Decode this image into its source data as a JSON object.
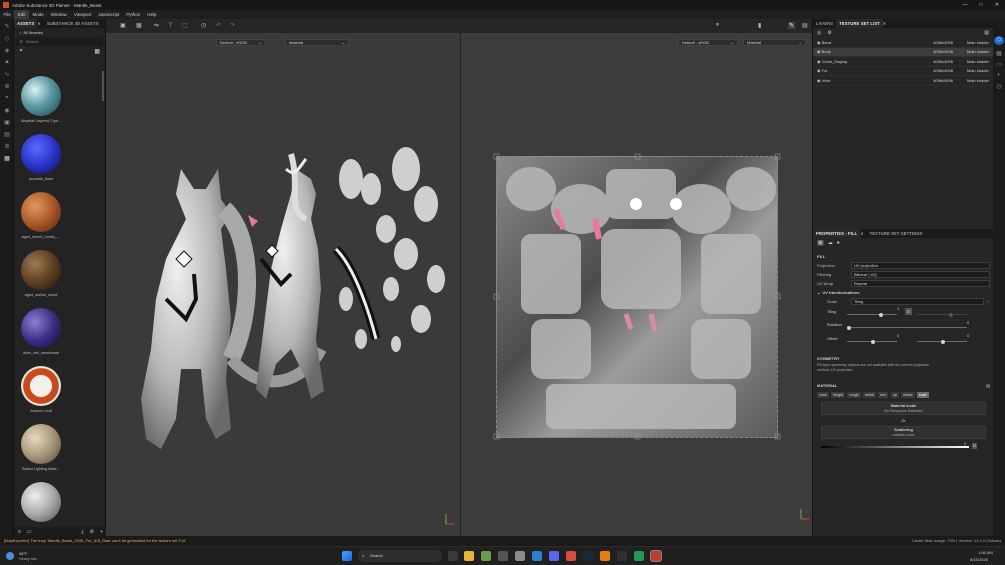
{
  "window": {
    "title": "Adobe Substance 3D Painter - Mantle_Beast"
  },
  "menu": [
    "File",
    "Edit",
    "Mode",
    "Window",
    "Viewport",
    "JavaScript",
    "Python",
    "Help"
  ],
  "assets": {
    "tabs": [
      "ASSETS",
      "SUBSTANCE 3D ASSETS"
    ],
    "library_label": "All libraries",
    "search_placeholder": "Search",
    "items": [
      {
        "name": "Abyssal Layered Crys..."
      },
      {
        "name": "acoustic_foam"
      },
      {
        "name": "aged_beech_honey_..."
      },
      {
        "name": "aged_walnut_wood"
      },
      {
        "name": "alien_cell_membrane"
      },
      {
        "name": "Autumn Leaf"
      },
      {
        "name": "Baked Lighting Mate..."
      },
      {
        "name": ""
      }
    ]
  },
  "viewport": {
    "left_colorspace": "Default - sRGB",
    "left_mode": "Material",
    "right_colorspace": "Default - sRGB",
    "right_mode": "Material"
  },
  "texture_set": {
    "tabs": [
      "LAYERS",
      "TEXTURE SET LIST"
    ],
    "rows": [
      {
        "name": "Band",
        "res": "4096x4096",
        "shader": "Main shader"
      },
      {
        "name": "Body",
        "res": "4096x4096",
        "shader": "Main shader"
      },
      {
        "name": "Chest_Display",
        "res": "4096x4096",
        "shader": "Main shader"
      },
      {
        "name": "Fur",
        "res": "4096x4096",
        "shader": "Main shader"
      },
      {
        "name": "Visor",
        "res": "4096x4096",
        "shader": "Main shader"
      }
    ]
  },
  "properties": {
    "tabs": [
      "PROPERTIES - FILL",
      "TEXTURE SET SETTINGS"
    ],
    "fill_label": "FILL",
    "projection_label": "Projection",
    "projection_value": "UV projection",
    "filtering_label": "Filtering",
    "filtering_value": "Bilinear | HQ",
    "uvwrap_label": "UV Wrap",
    "uvwrap_value": "Repeat",
    "uvtrans_label": "UV transformations",
    "scale_label": "Scale",
    "scale_value": "Tiling",
    "tiling_label": "Tiling",
    "tiling_value": "1",
    "rotation_label": "Rotation",
    "rotation_value": "0",
    "offset_label": "Offset",
    "offset_value_a": "0",
    "offset_value_b": "0",
    "symmetry_label": "SYMMETRY",
    "symmetry_note": "Fill layer symmetry options are not available with the current projection method: UV projection.",
    "material_label": "MATERIAL",
    "channels": [
      "color",
      "height",
      "rough",
      "metal",
      "nrm",
      "op",
      "emiss",
      "scatt"
    ],
    "active_channel": "scatt",
    "material_mode": "Material mode",
    "no_resource": "No Resource Selected",
    "or_text": "Or",
    "scattering": "Scattering",
    "uniform_color": "uniform color",
    "scatter_value": "0"
  },
  "status": {
    "message": "[MapExporter] The map 'Mantle_Beast_2026_Fur_ID3_Raw' can't be generated for the texture set 'Fur'",
    "cache": "Cache Disk Usage:   73% | Version: 12.0.0 (Vulkan)"
  },
  "taskbar": {
    "weather_temp": "58°F",
    "weather_desc": "Heavy rain",
    "search_placeholder": "Search",
    "time": "1:06 AM",
    "date": "5/15/2026"
  }
}
